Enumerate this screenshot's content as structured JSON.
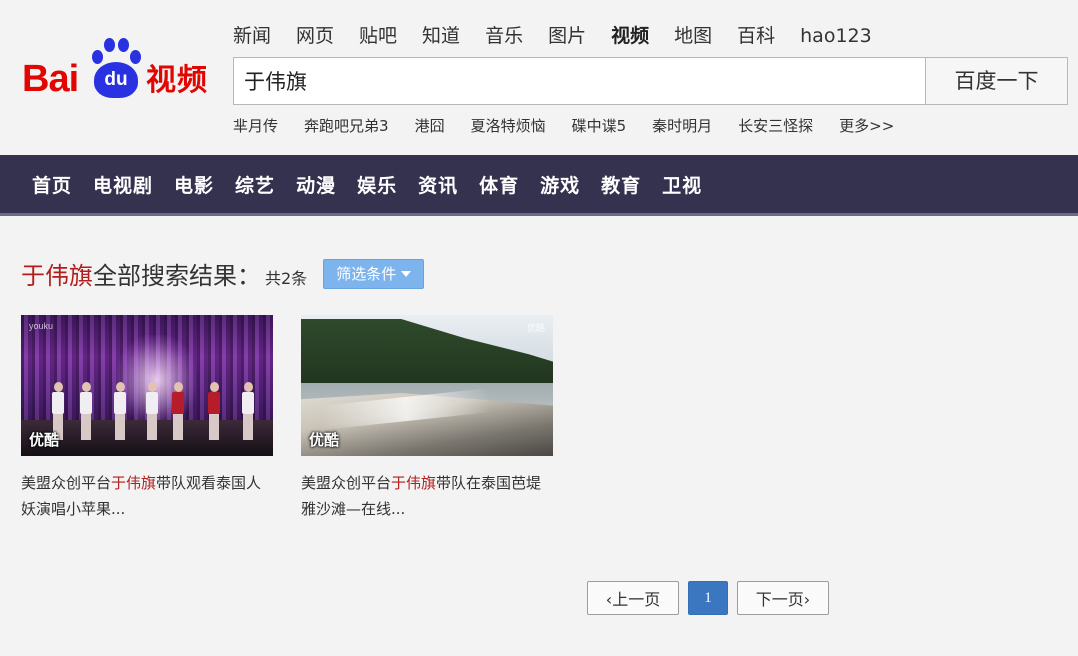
{
  "logo": {
    "text_bai": "Bai",
    "text_du": "du",
    "text_product": "视频"
  },
  "nav_top": [
    {
      "label": "新闻",
      "active": false
    },
    {
      "label": "网页",
      "active": false
    },
    {
      "label": "贴吧",
      "active": false
    },
    {
      "label": "知道",
      "active": false
    },
    {
      "label": "音乐",
      "active": false
    },
    {
      "label": "图片",
      "active": false
    },
    {
      "label": "视频",
      "active": true
    },
    {
      "label": "地图",
      "active": false
    },
    {
      "label": "百科",
      "active": false
    },
    {
      "label": "hao123",
      "active": false
    }
  ],
  "search": {
    "value": "于伟旗",
    "button_label": "百度一下"
  },
  "hot_words": [
    "芈月传",
    "奔跑吧兄弟3",
    "港囧",
    "夏洛特烦恼",
    "碟中谍5",
    "秦时明月",
    "长安三怪探",
    "更多>>"
  ],
  "category_bar": [
    "首页",
    "电视剧",
    "电影",
    "综艺",
    "动漫",
    "娱乐",
    "资讯",
    "体育",
    "游戏",
    "教育",
    "卫视"
  ],
  "result": {
    "keyword": "于伟旗",
    "title_suffix": "全部搜索结果：",
    "count_text": "共2条",
    "filter_label": "筛选条件"
  },
  "videos": [
    {
      "source": "优酷",
      "title_pre": "美盟众创平台",
      "title_hl": "于伟旗",
      "title_post": "带队观看泰国人妖演唱小苹果...",
      "watermark": "youku"
    },
    {
      "source": "优酷",
      "title_pre": "美盟众创平台",
      "title_hl": "于伟旗",
      "title_post": "带队在泰国芭堤雅沙滩—在线...",
      "watermark": "优酷"
    }
  ],
  "pagination": {
    "prev_label": "‹上一页",
    "current_page": "1",
    "next_label": "下一页›"
  },
  "colors": {
    "brand_red": "#e10602",
    "brand_blue": "#2932e1",
    "category_bar_bg": "#35324f",
    "keyword_highlight": "#b31d1d",
    "filter_button": "#7eb4ee",
    "current_page": "#3a77c0"
  }
}
